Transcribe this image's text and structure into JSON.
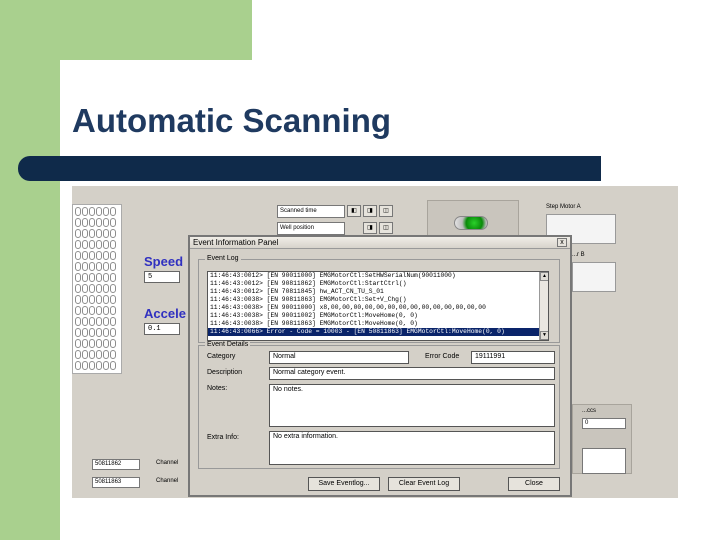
{
  "slide": {
    "title": "Automatic Scanning"
  },
  "app": {
    "speed_label": "Speed",
    "speed_value": "5",
    "accel_label": "Accele",
    "accel_value": "0.1",
    "top_field_1": "Scanned time",
    "top_field_2": "Well position",
    "motor_a_label": "Step Motor A",
    "motor_b_label": "...r B",
    "right_field_label": "...ccs",
    "right_field_value": "0",
    "serial_1": "50811862",
    "serial_2": "50811863",
    "channel_label": "Channel"
  },
  "dialog": {
    "title": "Event Information Panel",
    "close_label": "x",
    "event_log_label": "Event Log",
    "log_lines": [
      "11:46:43:0012> [EN 90011000] EMGMotorCtl:SetHWSerialNum(90011000)",
      "11:46:43:0012> [EN 90811862] EMGMotorCtl:StartCtrl()",
      "11:46:43:0012> [EN 70811845] hw_ACT_CN_TU_S_01",
      "11:46:43:0038> [EN 90811863] EMGMotorCtl:Set+V_Chg()",
      "11:46:43:0038> [EN 90011000] x8,00,00,00,00,00,00,00,00,00,00,00,00,00,00",
      "11:46:43:0038> [EN 90011002] EMGMotorCtl:MoveHome(0, 0)",
      "11:46:43:0038> [EN 90811863] EMGMotorCtl:MoveHome(0, 0)",
      "11:46:43:0066> Error - Code = 10003 - [EN 50811863] EMGMotorCtl:MoveHome(0, 0)"
    ],
    "details_label": "Event Details",
    "category_label": "Category",
    "category_value": "Normal",
    "errcode_label": "Error Code",
    "errcode_value": "19111991",
    "description_label": "Description",
    "description_value": "Normal category event.",
    "notes_label": "Notes:",
    "notes_value": "No notes.",
    "extra_label": "Extra Info:",
    "extra_value": "No extra information.",
    "save_button": "Save Eventlog...",
    "clear_button": "Clear Event Log",
    "close_button": "Close"
  }
}
